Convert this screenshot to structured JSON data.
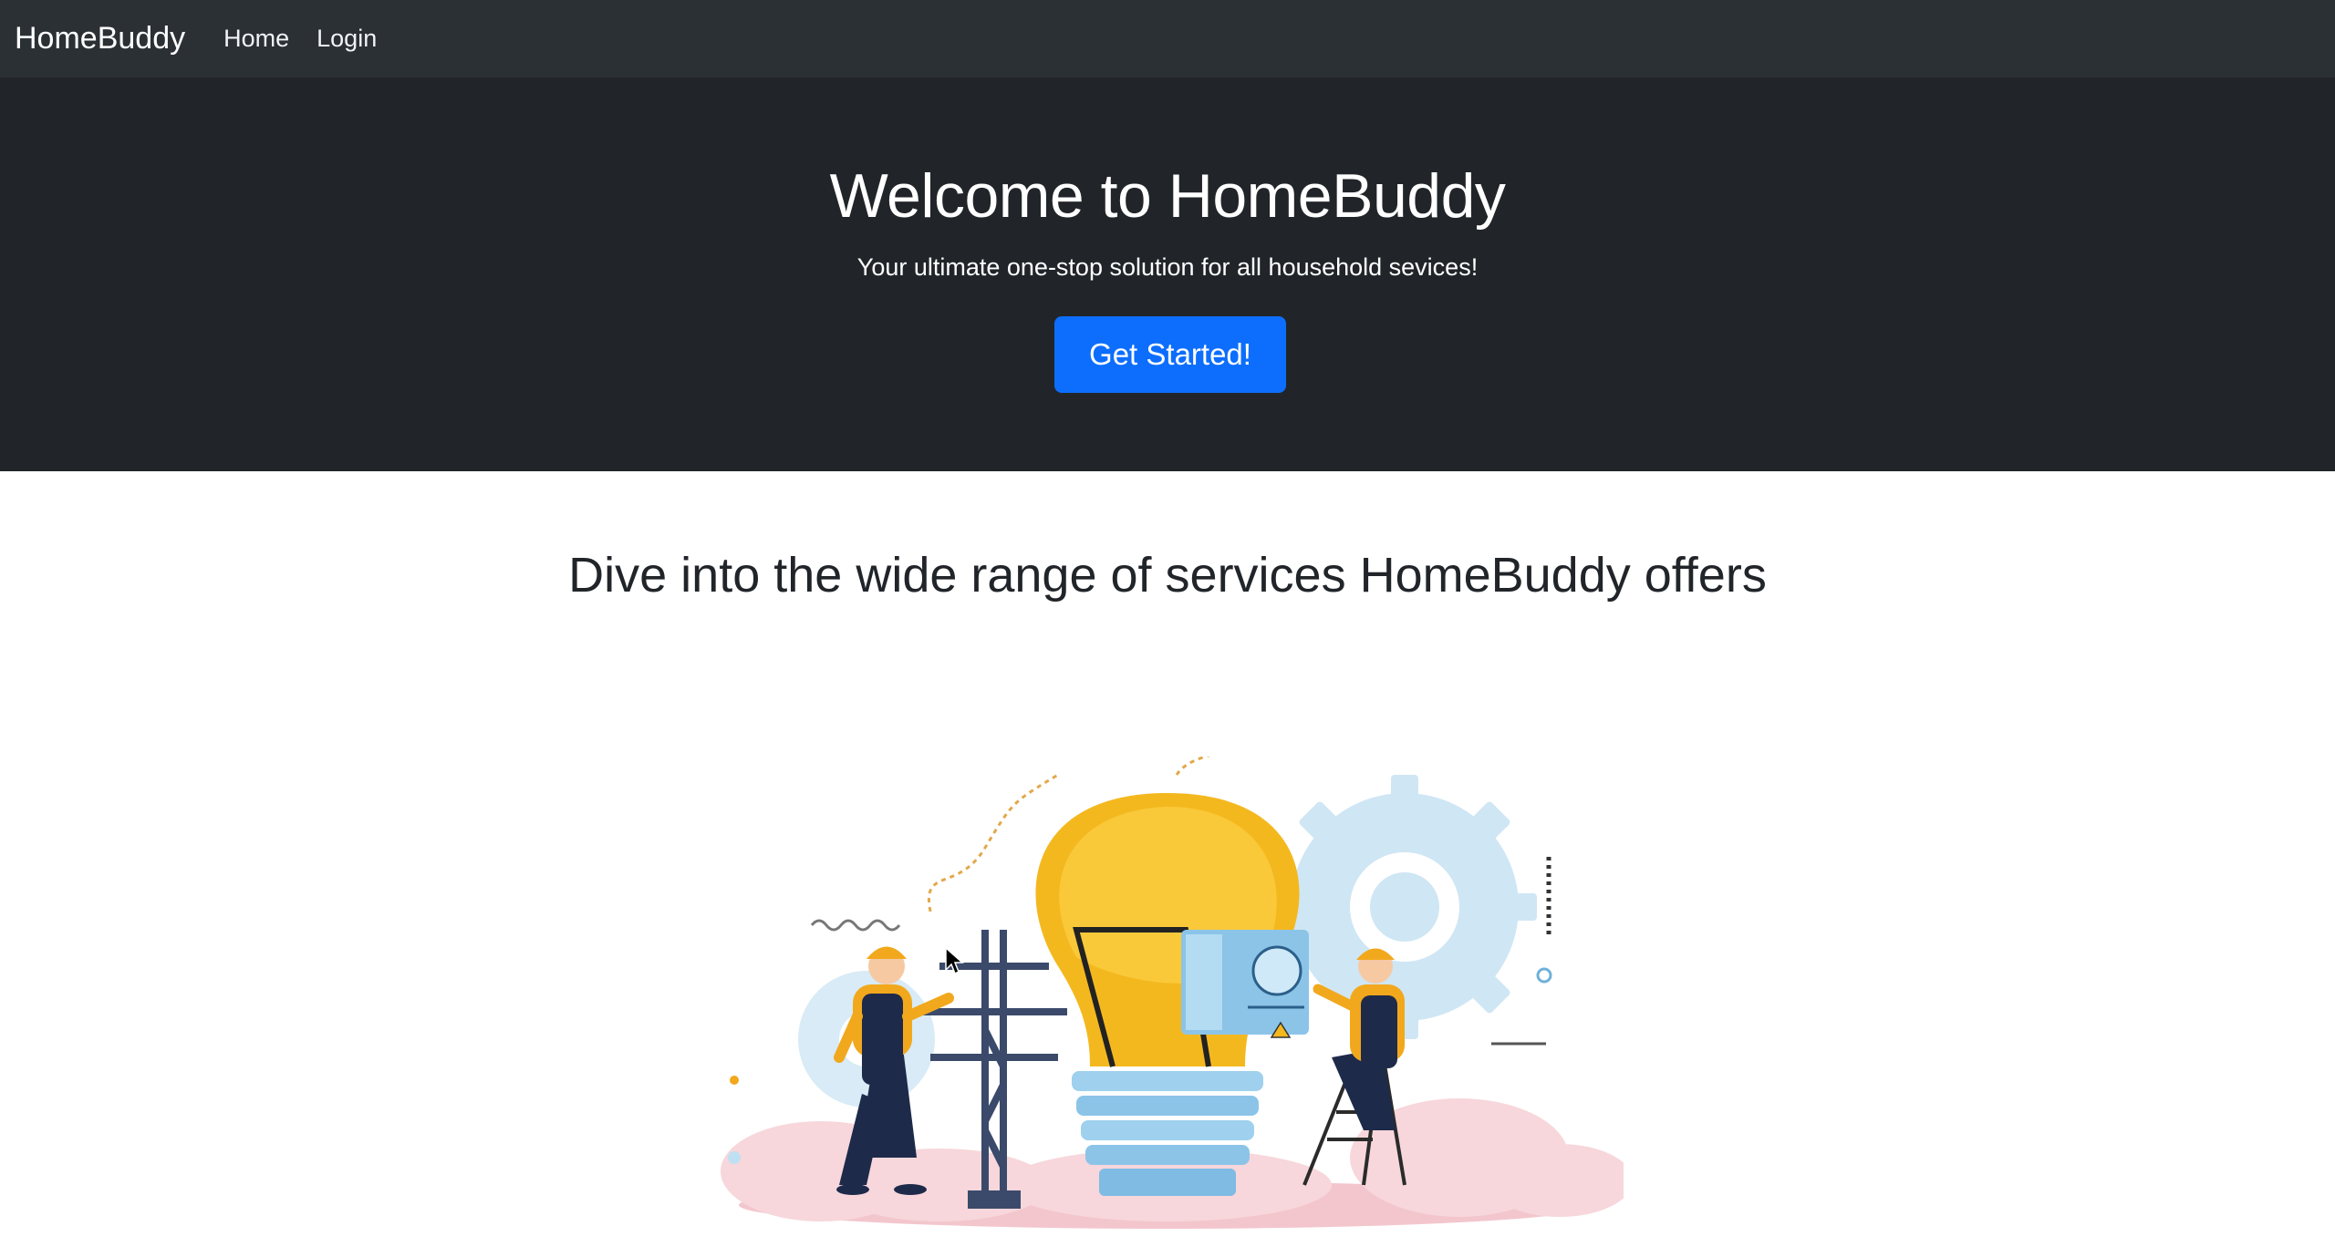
{
  "navbar": {
    "brand": "HomeBuddy",
    "links": [
      "Home",
      "Login"
    ]
  },
  "hero": {
    "title": "Welcome to HomeBuddy",
    "subtitle": "Your ultimate one-stop solution for all household sevices!",
    "button_label": "Get Started!"
  },
  "services": {
    "heading": "Dive into the wide range of services HomeBuddy offers",
    "illustration": "electricians-lightbulb-illustration"
  },
  "colors": {
    "navbar_bg": "#2b3035",
    "hero_bg": "#212529",
    "primary": "#0d6efd",
    "bulb": "#f7c022",
    "gear": "#c9e3f2",
    "cloud": "#f6d1d6"
  }
}
